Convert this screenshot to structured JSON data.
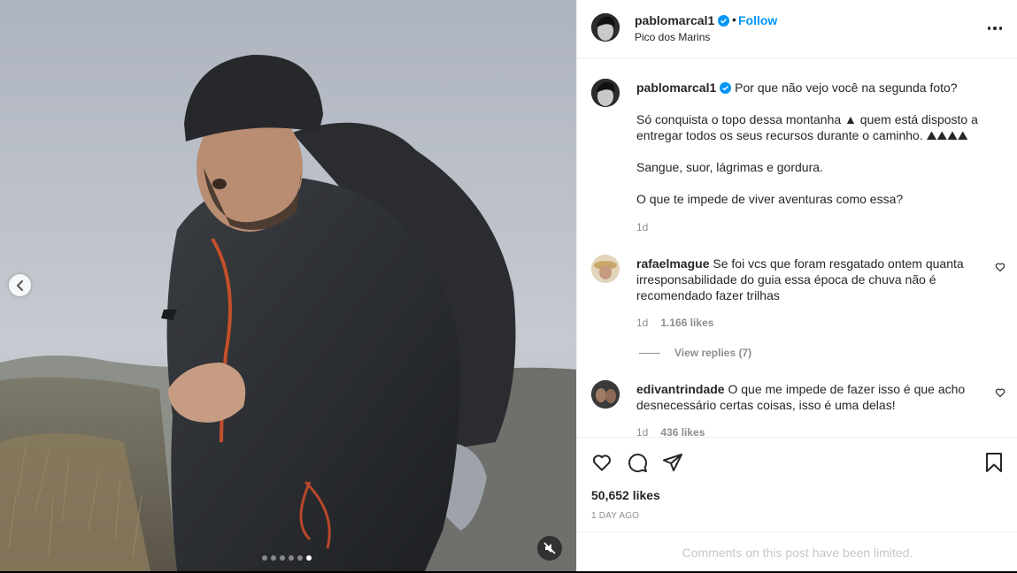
{
  "post": {
    "username": "pablomarcal1",
    "follow_label": "Follow",
    "separator": "•",
    "location": "Pico dos Marins",
    "carousel": {
      "total_slides": 6,
      "active_slide": 6
    }
  },
  "caption": {
    "username": "pablomarcal1",
    "line1": "Por que não vejo você na segunda foto?",
    "para2": "Só conquista o topo dessa montanha ▲ quem está disposto a entregar todos os seus recursos durante o caminho. ⛰⛰⛰⛰",
    "para3": "Sangue, suor, lágrimas e gordura.",
    "para4": "O que te impede de viver aventuras como essa?",
    "time": "1d"
  },
  "comments": [
    {
      "username": "rafaelmague",
      "text": "Se foi vcs que foram resgatado ontem quanta irresponsabilidade do guia essa época de chuva não é recomendado fazer trilhas",
      "time": "1d",
      "likes": "1.166 likes",
      "view_replies": "View replies (7)"
    },
    {
      "username": "edivantrindade",
      "text": "O que me impede de fazer isso é que acho desnecessário certas coisas, isso é uma delas!",
      "time": "1d",
      "likes": "436 likes"
    }
  ],
  "actions": {
    "likes": "50,652 likes",
    "time_ago": "1 DAY AGO",
    "limited_notice": "Comments on this post have been limited."
  },
  "icons": {
    "verified": "verified-badge-icon",
    "more": "more-options-icon",
    "like": "heart-icon",
    "comment": "comment-icon",
    "share": "share-icon",
    "save": "bookmark-icon",
    "prev": "chevron-left-icon",
    "mute": "muted-speaker-icon"
  },
  "colors": {
    "follow": "#0095f6",
    "verified": "#0095f6",
    "muted_text": "#8e8e8e"
  }
}
